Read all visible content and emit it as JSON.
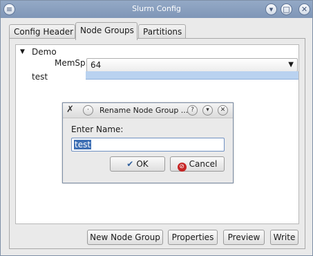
{
  "window": {
    "title": "Slurm Config"
  },
  "tabs": [
    {
      "label": "Config Header"
    },
    {
      "label": "Node Groups"
    },
    {
      "label": "Partitions"
    }
  ],
  "tree": {
    "groups": [
      {
        "name": "Demo",
        "expanded": true,
        "property_label": "MemSp...",
        "property_value": "64"
      },
      {
        "name": "test",
        "selected": true
      }
    ]
  },
  "buttons": {
    "new_node_group": "New Node Group",
    "properties": "Properties",
    "preview": "Preview",
    "write": "Write"
  },
  "dialog": {
    "title": "Rename Node Group ...",
    "prompt": "Enter Name:",
    "input_value": "test",
    "ok": "OK",
    "cancel": "Cancel"
  },
  "colors": {
    "titlebar": "#8aa0c0",
    "selection": "#b9d2f0",
    "text_selection": "#3d6fb4",
    "cancel_icon": "#c62525"
  }
}
